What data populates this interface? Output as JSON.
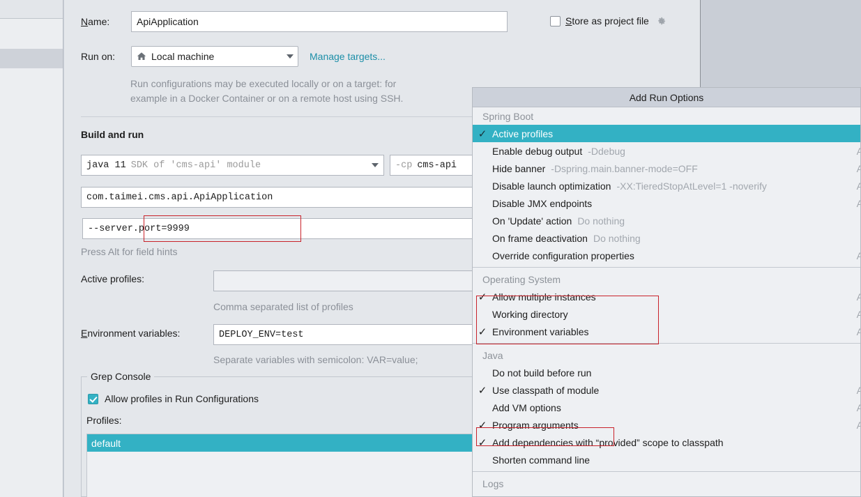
{
  "dialog": {
    "name_label": "Name:",
    "name_label_mnemonic": "N",
    "name_value": "ApiApplication",
    "store_as_project_file": "Store as project file",
    "store_mnemonic": "S",
    "store_checked": false,
    "gear_icon": "gear-icon",
    "run_on_label": "Run on:",
    "run_on_value": "Local machine",
    "run_on_icon": "home-icon",
    "manage_targets_link": "Manage targets...",
    "run_on_hint_line1": "Run configurations may be executed locally or on a target: for",
    "run_on_hint_line2": "example in a Docker Container or on a remote host using SSH.",
    "build_and_run_title": "Build and run",
    "sdk_main": "java 11",
    "sdk_dim": "SDK of 'cms-api' module",
    "cp_dim": "-cp",
    "cp_value": "cms-api",
    "main_class": "com.taimei.cms.api.ApiApplication",
    "program_args": "--server.port=9999",
    "alt_hint": "Press Alt for field hints",
    "active_profiles_label": "Active profiles:",
    "active_profiles_value": "",
    "active_profiles_hint": "Comma separated list of profiles",
    "env_vars_label": "Environment variables:",
    "env_vars_mnemonic": "E",
    "env_vars_value": "DEPLOY_ENV=test",
    "env_vars_hint": "Separate variables with semicolon: VAR=value;"
  },
  "grep_console": {
    "legend": "Grep Console",
    "allow_profiles_label": "Allow profiles in Run Configurations",
    "allow_profiles_checked": true,
    "profiles_label": "Profiles:",
    "profiles_items": [
      "default"
    ],
    "selected_profile": "default"
  },
  "popup": {
    "title": "Add Run Options",
    "accent_color": "#33b1c4",
    "groups": [
      {
        "header": "Spring Boot",
        "items": [
          {
            "label": "Active profiles",
            "value": "",
            "checked": true,
            "selected": true,
            "shortcut": ""
          },
          {
            "label": "Enable debug output",
            "value": "-Ddebug",
            "checked": false,
            "selected": false,
            "shortcut": "A"
          },
          {
            "label": "Hide banner",
            "value": "-Dspring.main.banner-mode=OFF",
            "checked": false,
            "selected": false,
            "shortcut": "A"
          },
          {
            "label": "Disable launch optimization",
            "value": "-XX:TieredStopAtLevel=1 -noverify",
            "checked": false,
            "selected": false,
            "shortcut": "A"
          },
          {
            "label": "Disable JMX endpoints",
            "value": "",
            "checked": false,
            "selected": false,
            "shortcut": "A"
          },
          {
            "label": "On 'Update' action",
            "value": "Do nothing",
            "checked": false,
            "selected": false,
            "shortcut": ""
          },
          {
            "label": "On frame deactivation",
            "value": "Do nothing",
            "checked": false,
            "selected": false,
            "shortcut": ""
          },
          {
            "label": "Override configuration properties",
            "value": "",
            "checked": false,
            "selected": false,
            "shortcut": "A"
          }
        ]
      },
      {
        "header": "Operating System",
        "items": [
          {
            "label": "Allow multiple instances",
            "value": "",
            "checked": true,
            "selected": false,
            "shortcut": "A"
          },
          {
            "label": "Working directory",
            "value": "",
            "checked": false,
            "selected": false,
            "shortcut": "A"
          },
          {
            "label": "Environment variables",
            "value": "",
            "checked": true,
            "selected": false,
            "shortcut": "A"
          }
        ]
      },
      {
        "header": "Java",
        "items": [
          {
            "label": "Do not build before run",
            "value": "",
            "checked": false,
            "selected": false,
            "shortcut": ""
          },
          {
            "label": "Use classpath of module",
            "value": "",
            "checked": true,
            "selected": false,
            "shortcut": "A"
          },
          {
            "label": "Add VM options",
            "value": "",
            "checked": false,
            "selected": false,
            "shortcut": "A"
          },
          {
            "label": "Program arguments",
            "value": "",
            "checked": true,
            "selected": false,
            "shortcut": "A"
          },
          {
            "label": "Add dependencies with “provided” scope to classpath",
            "value": "",
            "checked": true,
            "selected": false,
            "shortcut": ""
          },
          {
            "label": "Shorten command line",
            "value": "",
            "checked": false,
            "selected": false,
            "shortcut": ""
          }
        ]
      },
      {
        "header": "Logs",
        "items": []
      }
    ]
  },
  "highlights": {
    "color": "#c9222a",
    "regions": [
      "program-arguments-field",
      "operating-system-items",
      "program-arguments-menu-item"
    ]
  }
}
